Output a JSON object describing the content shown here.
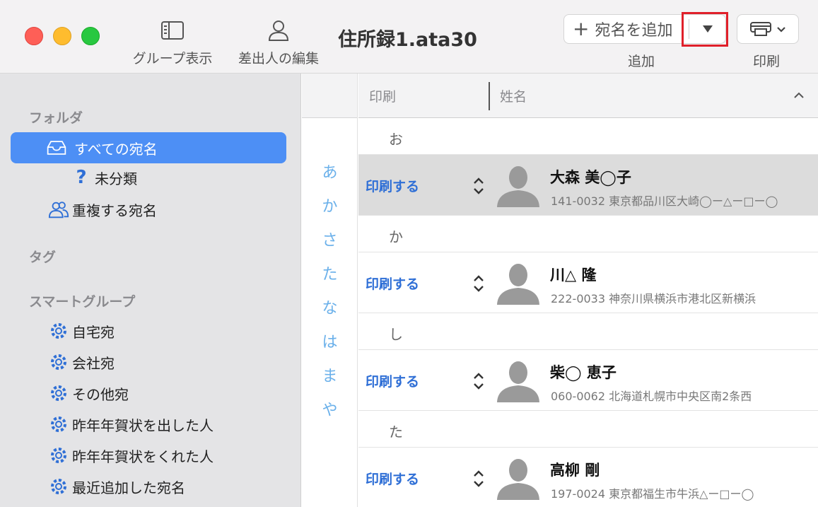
{
  "window": {
    "title": "住所録1.ata30"
  },
  "toolbar": {
    "group_view_label": "グループ表示",
    "edit_sender_label": "差出人の編集",
    "add_button_label": "宛名を追加",
    "add_group_label": "追加",
    "print_group_label": "印刷",
    "icons": {
      "group_view": "sidebar-icon",
      "edit_sender": "person-icon",
      "add": "plus-icon",
      "add_menu": "triangle-down-icon",
      "print": "printer-icon",
      "print_menu": "chevron-down-icon"
    },
    "highlight_color": "#e0202a"
  },
  "sidebar": {
    "folders_header": "フォルダ",
    "folders": [
      {
        "label": "すべての宛名",
        "icon": "tray-icon",
        "selected": true
      },
      {
        "label": "未分類",
        "icon": "question-icon",
        "selected": false
      },
      {
        "label": "重複する宛名",
        "icon": "people-icon",
        "selected": false
      }
    ],
    "tags_header": "タグ",
    "smart_header": "スマートグループ",
    "smart_groups": [
      {
        "label": "自宅宛",
        "icon": "gear-icon"
      },
      {
        "label": "会社宛",
        "icon": "gear-icon"
      },
      {
        "label": "その他宛",
        "icon": "gear-icon"
      },
      {
        "label": "昨年年賀状を出した人",
        "icon": "gear-icon"
      },
      {
        "label": "昨年年賀状をくれた人",
        "icon": "gear-icon"
      },
      {
        "label": "最近追加した宛名",
        "icon": "gear-icon"
      }
    ],
    "accent_color": "#4d8ff5"
  },
  "index_letters": [
    "あ",
    "か",
    "さ",
    "た",
    "な",
    "は",
    "ま",
    "や"
  ],
  "list": {
    "col_print": "印刷",
    "col_name": "姓名",
    "sections": [
      {
        "heading": "お",
        "entry": {
          "print": "印刷する",
          "name": "大森 美◯子",
          "address": "141-0032 東京都品川区大崎◯ー△ー□ー◯",
          "selected": true
        }
      },
      {
        "heading": "か",
        "entry": {
          "print": "印刷する",
          "name": "川△ 隆",
          "address": "222-0033 神奈川県横浜市港北区新横浜",
          "selected": false
        }
      },
      {
        "heading": "し",
        "entry": {
          "print": "印刷する",
          "name": "柴◯ 恵子",
          "address": "060-0062 北海道札幌市中央区南2条西",
          "selected": false
        }
      },
      {
        "heading": "た",
        "entry": {
          "print": "印刷する",
          "name": "高柳 剛",
          "address": "197-0024 東京都福生市牛浜△ー□ー◯",
          "selected": false
        }
      }
    ],
    "print_color": "#2f6fd6"
  }
}
